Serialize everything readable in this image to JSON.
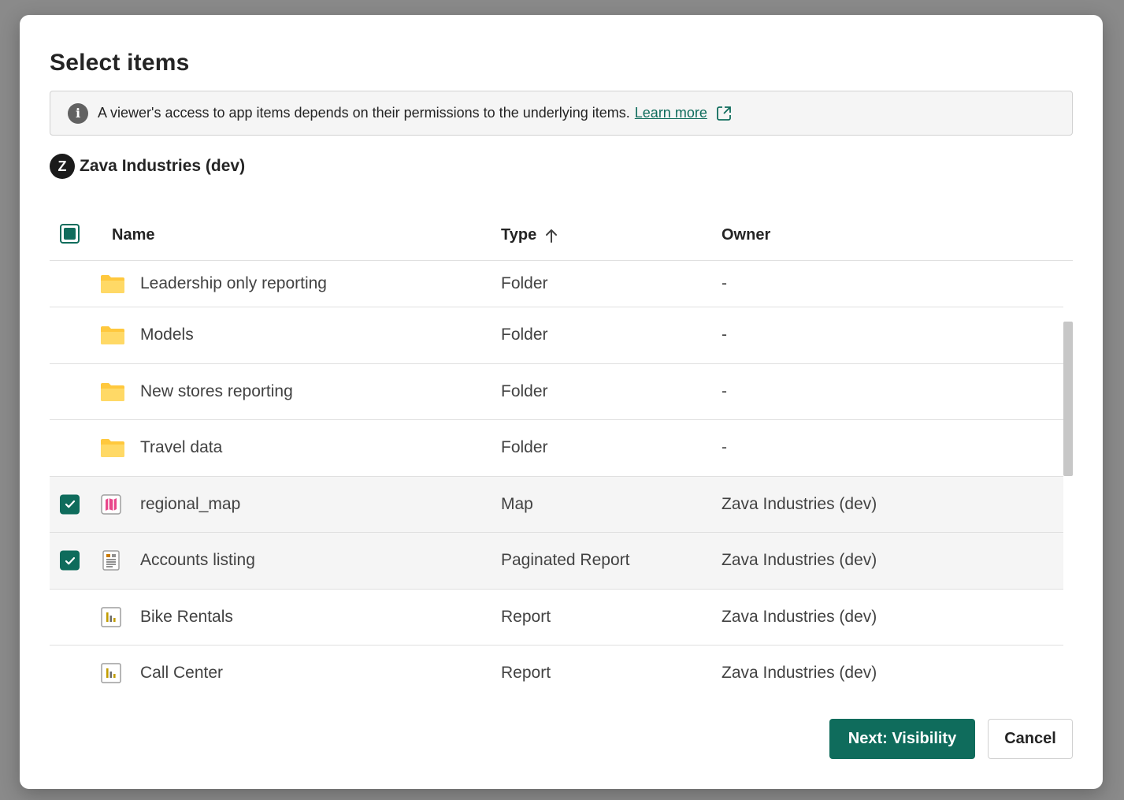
{
  "dialog": {
    "title": "Select items",
    "banner": {
      "icon": "info-icon",
      "text": "A viewer's access to app items depends on their permissions to the underlying items.",
      "link_text": "Learn more",
      "link_icon": "open-external-icon"
    },
    "workspace": {
      "avatar_letter": "Z",
      "name": "Zava Industries (dev)"
    },
    "table": {
      "header_checkbox_state": "indeterminate",
      "columns": {
        "name": "Name",
        "type": "Type",
        "type_sort_icon": "arrow-up-icon",
        "owner": "Owner"
      },
      "rows": [
        {
          "icon": "folder-icon",
          "name": "Leadership only reporting",
          "type": "Folder",
          "owner": "-",
          "checked": null
        },
        {
          "icon": "folder-icon",
          "name": "Models",
          "type": "Folder",
          "owner": "-",
          "checked": null
        },
        {
          "icon": "folder-icon",
          "name": "New stores reporting",
          "type": "Folder",
          "owner": "-",
          "checked": null
        },
        {
          "icon": "folder-icon",
          "name": "Travel data",
          "type": "Folder",
          "owner": "-",
          "checked": null
        },
        {
          "icon": "map-icon",
          "name": "regional_map",
          "type": "Map",
          "owner": "Zava Industries (dev)",
          "checked": true
        },
        {
          "icon": "paginated-report-icon",
          "name": "Accounts listing",
          "type": "Paginated Report",
          "owner": "Zava Industries (dev)",
          "checked": true
        },
        {
          "icon": "report-icon",
          "name": "Bike Rentals",
          "type": "Report",
          "owner": "Zava Industries (dev)",
          "checked": false
        },
        {
          "icon": "report-icon",
          "name": "Call Center",
          "type": "Report",
          "owner": "Zava Industries (dev)",
          "checked": false
        }
      ]
    },
    "buttons": {
      "next": "Next: Visibility",
      "cancel": "Cancel"
    }
  },
  "colors": {
    "accent": "#0f6c5c",
    "folder": "#ffc83d",
    "map": "#c03b8a",
    "report": "#c19c00",
    "selected_row": "#f5f5f5"
  }
}
